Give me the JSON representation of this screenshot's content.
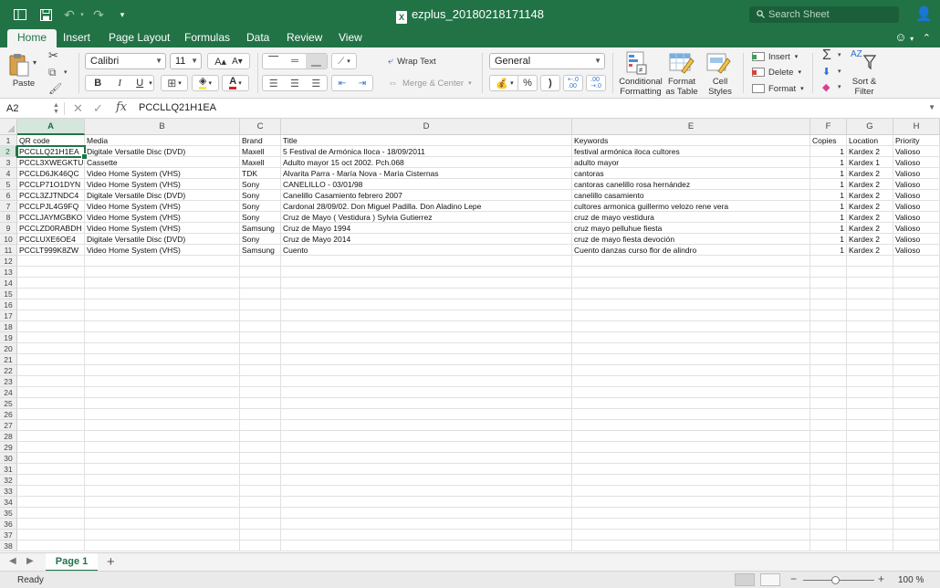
{
  "window": {
    "title": "ezplus_20180218171148",
    "search_placeholder": "Search Sheet"
  },
  "tabs": [
    "Home",
    "Insert",
    "Page Layout",
    "Formulas",
    "Data",
    "Review",
    "View"
  ],
  "active_tab": "Home",
  "ribbon": {
    "paste": "Paste",
    "font_name": "Calibri",
    "font_size": "11",
    "wrap_text": "Wrap Text",
    "merge_center": "Merge & Center",
    "number_format": "General",
    "percent": "%",
    "comma": ")",
    "conditional_formatting": [
      "Conditional",
      "Formatting"
    ],
    "format_as_table": [
      "Format",
      "as Table"
    ],
    "cell_styles": [
      "Cell",
      "Styles"
    ],
    "insert": "Insert",
    "delete": "Delete",
    "format": "Format",
    "sort_filter": [
      "Sort &",
      "Filter"
    ],
    "bold": "B",
    "italic": "I",
    "underline": "U",
    "autosum": "Σ",
    "sort_glyph": "AZ"
  },
  "formula_bar": {
    "name_box": "A2",
    "fx": "fx",
    "content": "PCCLLQ21H1EA"
  },
  "grid": {
    "columns": [
      "A",
      "B",
      "C",
      "D",
      "E",
      "F",
      "G",
      "H"
    ],
    "row_numbers": [
      "1",
      "2",
      "3",
      "4",
      "5",
      "6",
      "7",
      "8",
      "9",
      "10",
      "11",
      "12",
      "13",
      "14",
      "15",
      "16",
      "17",
      "18",
      "19",
      "20",
      "21",
      "22",
      "23",
      "24",
      "25",
      "26",
      "27",
      "28",
      "29",
      "30",
      "31",
      "32",
      "33",
      "34",
      "35",
      "36",
      "37",
      "38"
    ],
    "rows": [
      [
        "QR code",
        "Media",
        "Brand",
        "Title",
        "Keywords",
        "Copies",
        "Location",
        "Priority"
      ],
      [
        "PCCLLQ21H1EA",
        "Digitale Versatile Disc (DVD)",
        "Maxell",
        "5 Festival de Armónica Iloca - 18/09/2011",
        "festival armónica iloca cultores",
        "1",
        "Kardex 2",
        "Valioso"
      ],
      [
        "PCCL3XWEGKTU",
        "Cassette",
        "Maxell",
        "Adulto mayor 15 oct 2002. Pch.068",
        "adulto mayor",
        "1",
        "Kardex 1",
        "Valioso"
      ],
      [
        "PCCLD6JK46QC",
        "Video Home System (VHS)",
        "TDK",
        "Alvarita Parra - María Nova - María Cisternas",
        "cantoras",
        "1",
        "Kardex 2",
        "Valioso"
      ],
      [
        "PCCLP71O1DYN",
        "Video Home System (VHS)",
        "Sony",
        "CANELILLO - 03/01/98",
        "cantoras canelillo rosa hernández",
        "1",
        "Kardex 2",
        "Valioso"
      ],
      [
        "PCCL3ZJTNDC4",
        "Digitale Versatile Disc (DVD)",
        "Sony",
        "Canelillo Casamiento febrero 2007",
        "canelillo casamiento",
        "1",
        "Kardex 2",
        "Valioso"
      ],
      [
        "PCCLPJL4G9FQ",
        "Video Home System (VHS)",
        "Sony",
        "Cardonal 28/09/02. Don Miguel Padilla. Don Aladino Lepe",
        "cultores armonica guillermo velozo rene vera",
        "1",
        "Kardex 2",
        "Valioso"
      ],
      [
        "PCCLJAYMGBKO",
        "Video Home System (VHS)",
        "Sony",
        "Cruz de Mayo ( Vestidura ) Sylvia Gutierrez",
        "cruz de mayo vestidura",
        "1",
        "Kardex 2",
        "Valioso"
      ],
      [
        "PCCLZD0RABDH",
        "Video Home System (VHS)",
        "Samsung",
        "Cruz de Mayo 1994",
        "cruz mayo pelluhue fiesta",
        "1",
        "Kardex 2",
        "Valioso"
      ],
      [
        "PCCLUXE6OE4",
        "Digitale Versatile Disc (DVD)",
        "Sony",
        "Cruz de Mayo 2014",
        "cruz de mayo fiesta devoción",
        "1",
        "Kardex 2",
        "Valioso"
      ],
      [
        "PCCLT999K8ZW",
        "Video Home System (VHS)",
        "Samsung",
        "Cuento",
        "Cuento danzas curso flor de alindro",
        "1",
        "Kardex 2",
        "Valioso"
      ]
    ]
  },
  "sheets": [
    "Page 1"
  ],
  "status": {
    "text": "Ready",
    "zoom": "100 %"
  }
}
